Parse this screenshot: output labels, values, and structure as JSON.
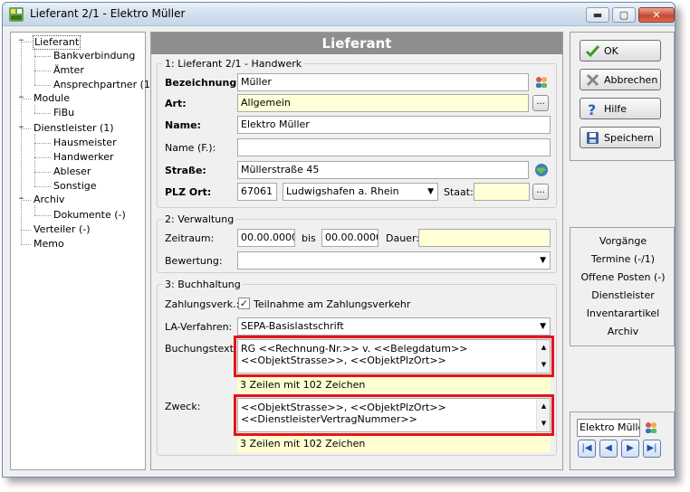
{
  "window": {
    "title": "Lieferant 2/1 - Elektro Müller",
    "minimize": "▬",
    "maximize": "▢",
    "close": "✕"
  },
  "tree": {
    "items": [
      {
        "label": "Lieferant",
        "level": 0,
        "selected": true
      },
      {
        "label": "Bankverbindung",
        "level": 1
      },
      {
        "label": "Ämter",
        "level": 1
      },
      {
        "label": "Ansprechpartner (1)",
        "level": 1
      },
      {
        "label": "Module",
        "level": 0
      },
      {
        "label": "FiBu",
        "level": 1
      },
      {
        "label": "Dienstleister (1)",
        "level": 0
      },
      {
        "label": "Hausmeister",
        "level": 1
      },
      {
        "label": "Handwerker",
        "level": 1
      },
      {
        "label": "Ableser",
        "level": 1
      },
      {
        "label": "Sonstige",
        "level": 1
      },
      {
        "label": "Archiv",
        "level": 0
      },
      {
        "label": "Dokumente (-)",
        "level": 1
      },
      {
        "label": "Verteiler (-)",
        "level": 0
      },
      {
        "label": "Memo",
        "level": 0
      }
    ]
  },
  "main": {
    "header": "Lieferant",
    "section1": {
      "title": "1: Lieferant 2/1 - Handwerk",
      "bezeichnung_label": "Bezeichnung:",
      "bezeichnung_value": "Müller",
      "art_label": "Art:",
      "art_value": "Allgemein",
      "name_label": "Name:",
      "name_value": "Elektro Müller",
      "name_f_label": "Name (F.):",
      "name_f_value": "",
      "strasse_label": "Straße:",
      "strasse_value": "Müllerstraße 45",
      "plz_ort_label": "PLZ Ort:",
      "plz_value": "67061",
      "ort_value": "Ludwigshafen a. Rhein",
      "staat_label": "Staat:",
      "staat_value": "",
      "ellipsis": "..."
    },
    "section2": {
      "title": "2: Verwaltung",
      "zeitraum_label": "Zeitraum:",
      "from_value": "00.00.0000",
      "bis_label": "bis",
      "to_value": "00.00.0000",
      "dauer_label": "Dauer:",
      "dauer_value": "",
      "bewertung_label": "Bewertung:",
      "bewertung_value": ""
    },
    "section3": {
      "title": "3: Buchhaltung",
      "zahlungsverk_label": "Zahlungsverk.:",
      "teilnahme_label": "Teilnahme am Zahlungsverkehr",
      "teilnahme_checked": "✓",
      "la_verfahren_label": "LA-Verfahren:",
      "la_verfahren_value": "SEPA-Basislastschrift",
      "buchungstext_label": "Buchungstext:",
      "buchungstext_line1": "RG <<Rechnung-Nr.>> v. <<Belegdatum>>",
      "buchungstext_line2": "<<ObjektStrasse>>, <<ObjektPlzOrt>>",
      "buchungstext_info": "3 Zeilen mit 102 Zeichen",
      "zweck_label": "Zweck:",
      "zweck_line1": "<<ObjektStrasse>>, <<ObjektPlzOrt>>",
      "zweck_line2": "<<DienstleisterVertragNummer>>",
      "zweck_info": "3 Zeilen mit 102 Zeichen"
    }
  },
  "actions": {
    "ok": "OK",
    "abbrechen": "Abbrechen",
    "hilfe": "Hilfe",
    "speichern": "Speichern"
  },
  "links": [
    "Vorgänge",
    "Termine (-/1)",
    "Offene Posten (-)",
    "Dienstleister",
    "Inventarartikel",
    "Archiv"
  ],
  "navigator": {
    "object_name": "Elektro Müller",
    "first": "|◀",
    "prev": "◀",
    "next": "▶",
    "last": "▶|"
  },
  "colors": {
    "header_bg": "#8e8e8e",
    "highlight_red": "#e5141b",
    "required_yellow": "#ffffd8"
  }
}
